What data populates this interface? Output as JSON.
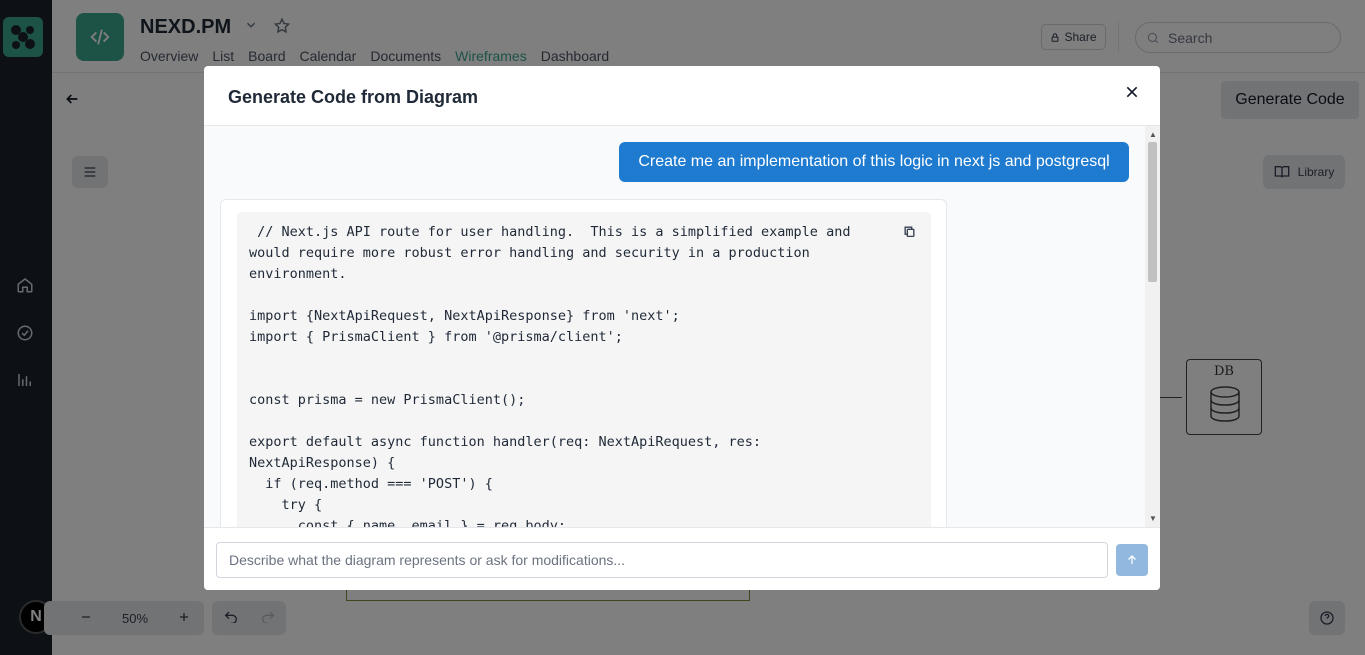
{
  "header": {
    "project_title": "NEXD.PM",
    "nav": [
      "Overview",
      "List",
      "Board",
      "Calendar",
      "Documents",
      "Wireframes",
      "Dashboard"
    ],
    "active_nav": "Wireframes",
    "share_label": "Share",
    "search_placeholder": "Search"
  },
  "sidebar": {
    "icons": [
      "home-icon",
      "check-circle-icon",
      "chart-icon"
    ],
    "avatar_label": "N"
  },
  "canvas": {
    "generate_code_label": "Generate Code",
    "library_label": "Library",
    "zoom_level": "50%",
    "db_label": "DB"
  },
  "modal": {
    "title": "Generate Code from Diagram",
    "user_message": "Create me an implementation of this logic in next js and postgresql",
    "code_lines": [
      " // Next.js API route for user handling.  This is a simplified example and",
      "would require more robust error handling and security in a production",
      "environment.",
      "",
      "import {NextApiRequest, NextApiResponse} from 'next';",
      "import { PrismaClient } from '@prisma/client';",
      "",
      "",
      "const prisma = new PrismaClient();",
      "",
      "export default async function handler(req: NextApiRequest, res:",
      "NextApiResponse) {",
      "  if (req.method === 'POST') {",
      "    try {",
      "      const { name, email } = req.body;"
    ],
    "input_placeholder": "Describe what the diagram represents or ask for modifications..."
  },
  "colors": {
    "accent": "#3aa58f",
    "user_bubble": "#1f7bd0",
    "rail": "#1b222c"
  }
}
